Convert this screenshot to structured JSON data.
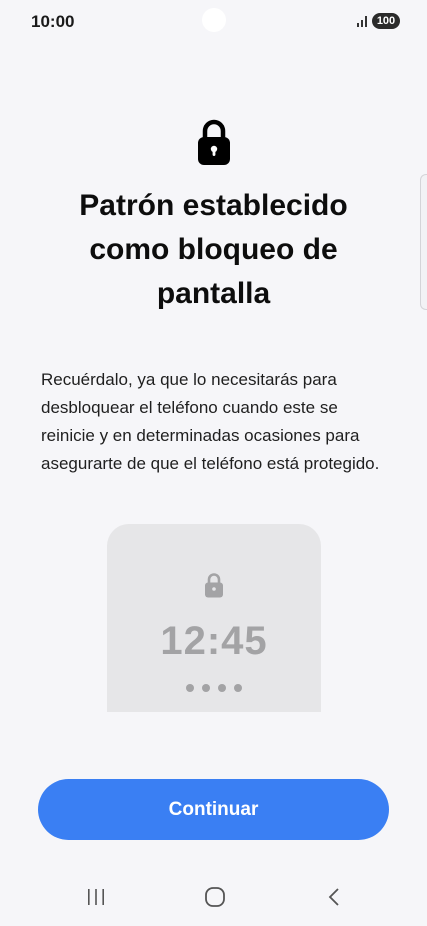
{
  "status_bar": {
    "time": "10:00",
    "battery": "100",
    "signal_icon": "signal-bars-icon"
  },
  "header": {
    "lock_icon": "lock-icon",
    "title": "Patrón establecido como bloqueo de pantalla"
  },
  "main": {
    "description": "Recuérdalo, ya que lo necesitarás para desbloquear el teléfono cuando este se reinicie y en determinadas ocasiones para asegurarte de que el teléfono está protegido.",
    "preview": {
      "lock_icon": "lock-icon",
      "time": "12:45",
      "dot_count": 4
    }
  },
  "actions": {
    "continue_label": "Continuar"
  },
  "nav_bar": {
    "recents_icon": "recents-icon",
    "home_icon": "home-icon",
    "back_icon": "back-icon"
  },
  "colors": {
    "background": "#f6f6f9",
    "accent": "#3a7ff3",
    "preview_card": "#e6e6e8",
    "preview_text": "#a3a3a5"
  }
}
